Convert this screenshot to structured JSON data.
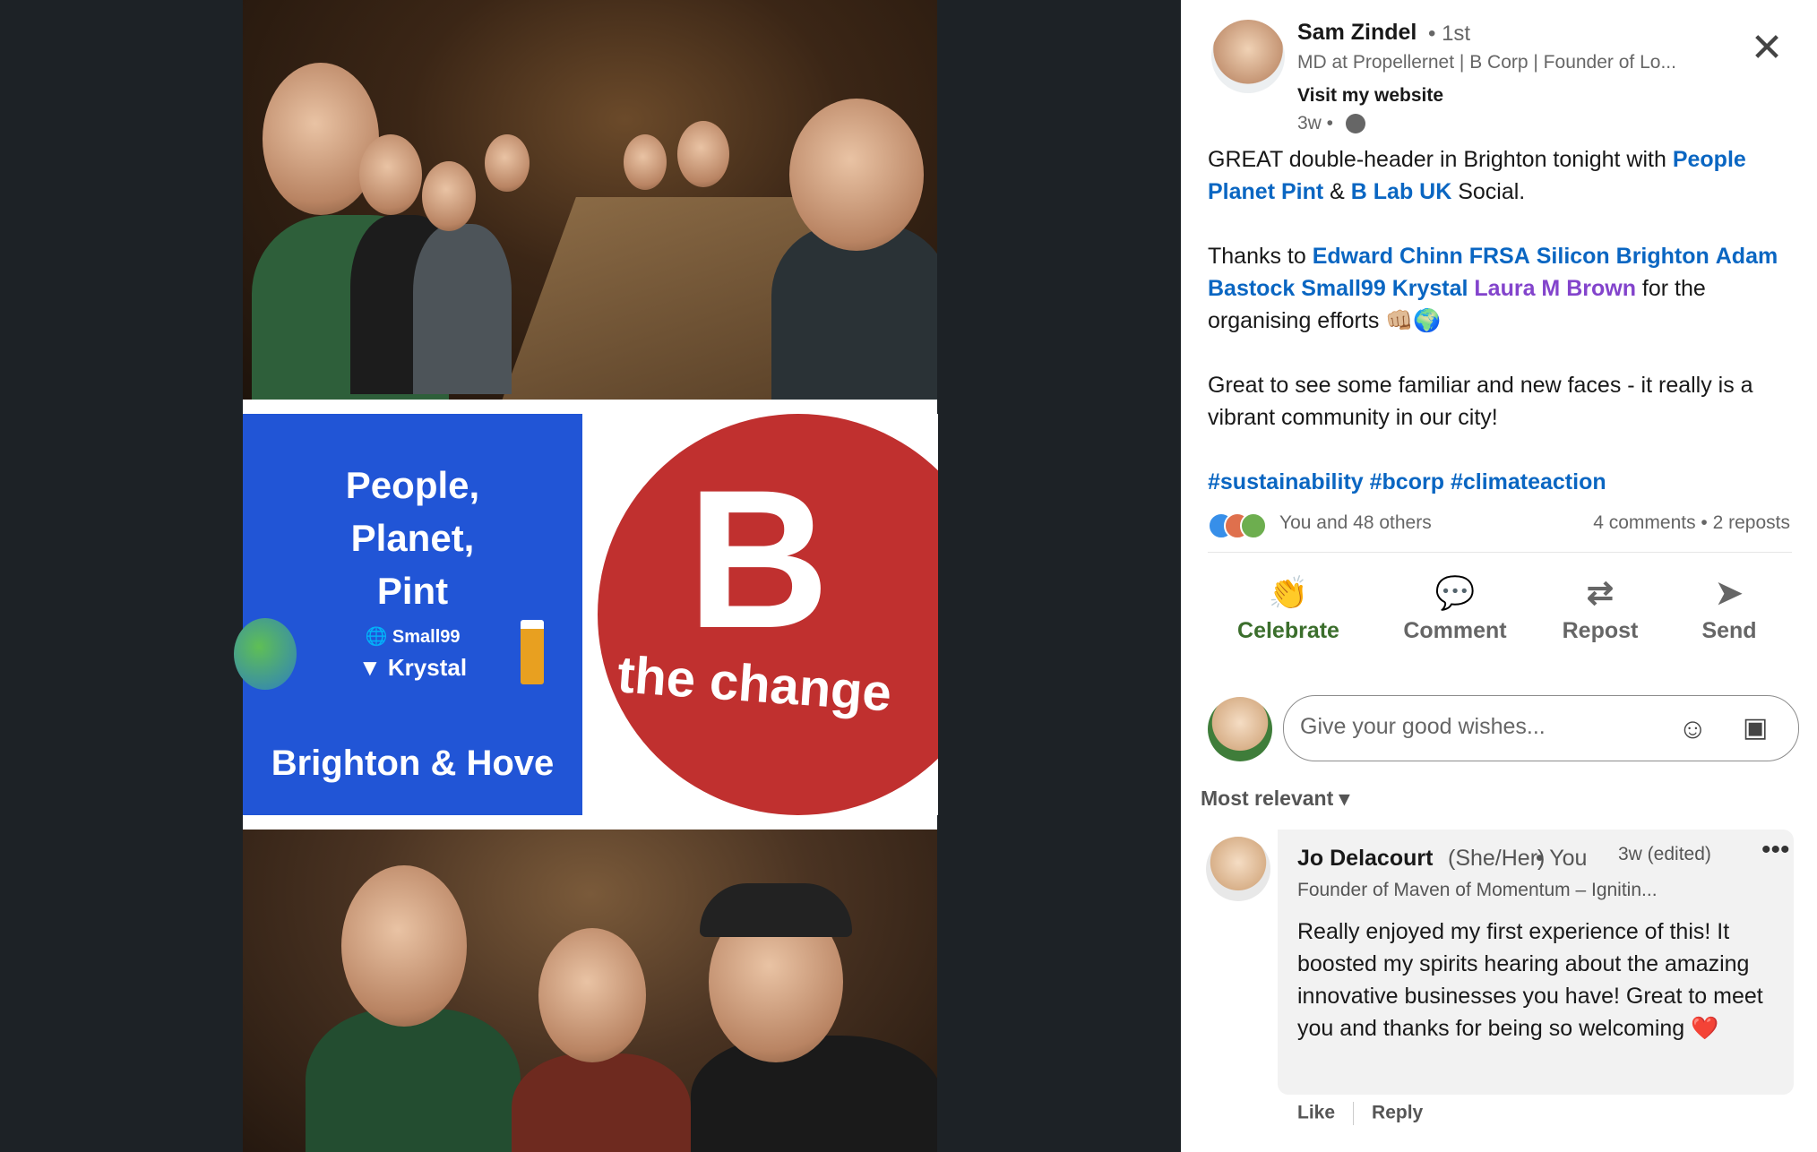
{
  "post": {
    "author": {
      "name": "Sam Zindel",
      "degree": "• 1st",
      "headline": "MD at Propellernet | B Corp | Founder of Lo...",
      "website_label": "Visit my website",
      "time": "3w •"
    },
    "body": {
      "p1_a": "GREAT double-header in Brighton tonight with ",
      "p1_link1": "People Planet Pint",
      "p1_b": " & ",
      "p1_link2": "B Lab UK",
      "p1_c": " Social.",
      "p2_a": "Thanks to ",
      "p2_mentions": [
        "Edward Chinn FRSA",
        "Silicon Brighton",
        "Adam Bastock",
        "Small99",
        "Krystal"
      ],
      "p2_mention_purple": "Laura M Brown",
      "p2_b": " for the organising efforts 👊🏼🌍",
      "p3": "Great to see some familiar and new faces - it really is a vibrant community in our city!",
      "hashtags": [
        "#sustainability",
        "#bcorp",
        "#climateaction"
      ]
    },
    "social": {
      "reactions_text": "You and 48 others",
      "stats": "4 comments • 2 reposts"
    },
    "actions": [
      {
        "label": "Celebrate",
        "icon": "👏"
      },
      {
        "label": "Comment",
        "icon": "💬"
      },
      {
        "label": "Repost",
        "icon": "⇄"
      },
      {
        "label": "Send",
        "icon": "➤"
      }
    ],
    "compose": {
      "placeholder": "Give your good wishes..."
    },
    "sort_label": "Most relevant ▾"
  },
  "comment": {
    "name": "Jo Delacourt",
    "pronouns": "(She/Her)",
    "you": "• You",
    "time": "3w (edited)",
    "more": "•••",
    "headline": "Founder of Maven of Momentum – Ignitin...",
    "text": "Really enjoyed my first experience of this! It boosted my spirits hearing about the amazing innovative businesses you have! Great to meet you and thanks for being so welcoming ❤️",
    "like": "Like",
    "reply": "Reply"
  },
  "media": {
    "ppp": {
      "title_lines": [
        "People,",
        "Planet,",
        "Pint"
      ],
      "brand1": "Small99",
      "brand2": "Krystal",
      "city": "Brighton & Hove"
    },
    "bcorp": {
      "letter": "B",
      "tagline": "the change"
    }
  },
  "colors": {
    "link": "#0a66c2",
    "mention_purple": "#8344cc",
    "celebrate": "#3b6e2c",
    "ppp_blue": "#2155d6",
    "bcorp_red": "#c0302f"
  }
}
